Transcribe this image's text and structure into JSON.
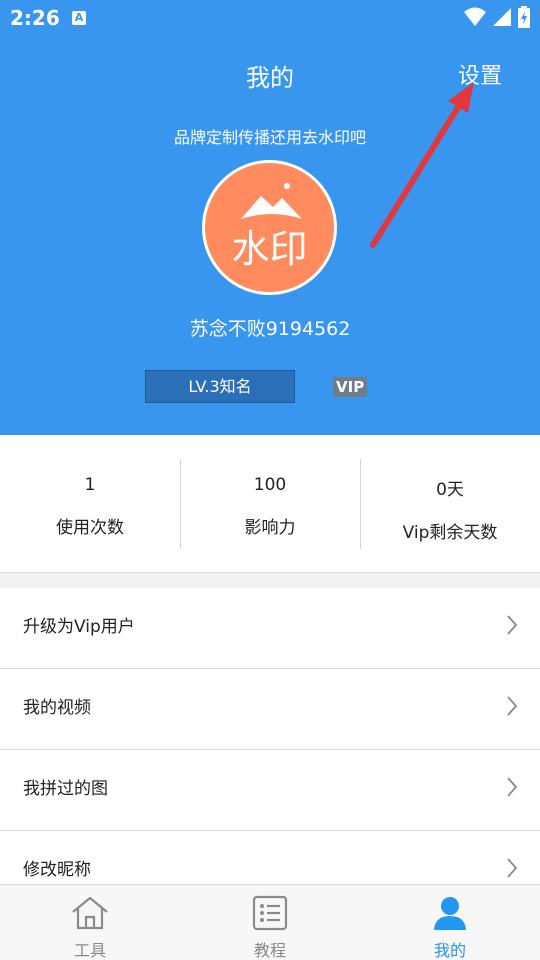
{
  "status_bar": {
    "time": "2:26",
    "notification_glyph": "A"
  },
  "header": {
    "title": "我的",
    "settings_label": "设置",
    "slogan": "品牌定制传播还用去水印吧",
    "avatar_text": "水印",
    "username": "苏念不败9194562",
    "level": "LV.3知名",
    "vip": "VIP"
  },
  "stats": [
    {
      "value": "1",
      "label": "使用次数"
    },
    {
      "value": "100",
      "label": "影响力"
    },
    {
      "value": "0天",
      "label": "Vip剩余天数"
    }
  ],
  "menu": [
    {
      "label": "升级为Vip用户"
    },
    {
      "label": "我的视频"
    },
    {
      "label": "我拼过的图"
    },
    {
      "label": "修改昵称"
    }
  ],
  "tabs": [
    {
      "label": "工具",
      "icon": "home-icon",
      "active": false
    },
    {
      "label": "教程",
      "icon": "list-icon",
      "active": false
    },
    {
      "label": "我的",
      "icon": "user-icon",
      "active": true
    }
  ],
  "colors": {
    "primary": "#3896ee",
    "avatar": "#ff8b5e",
    "arrow": "#e0383e",
    "active_tab": "#2196f3"
  }
}
